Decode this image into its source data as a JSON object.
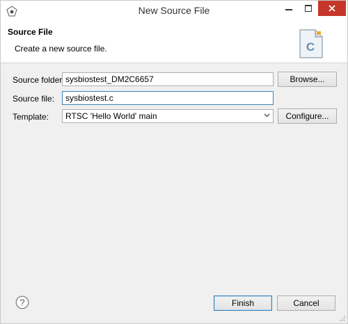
{
  "window": {
    "title": "New Source File"
  },
  "header": {
    "title": "Source File",
    "description": "Create a new source file."
  },
  "form": {
    "source_folder_label": "Source folder:",
    "source_folder_value": "sysbiostest_DM2C6657",
    "browse_label": "Browse...",
    "source_file_label": "Source file:",
    "source_file_value": "sysbiostest.c",
    "template_label": "Template:",
    "template_value": "RTSC 'Hello World' main",
    "configure_label": "Configure..."
  },
  "footer": {
    "finish_label": "Finish",
    "cancel_label": "Cancel"
  },
  "icons": {
    "app": "eclipse-icon",
    "header": "c-source-file-icon",
    "help": "help-icon"
  }
}
